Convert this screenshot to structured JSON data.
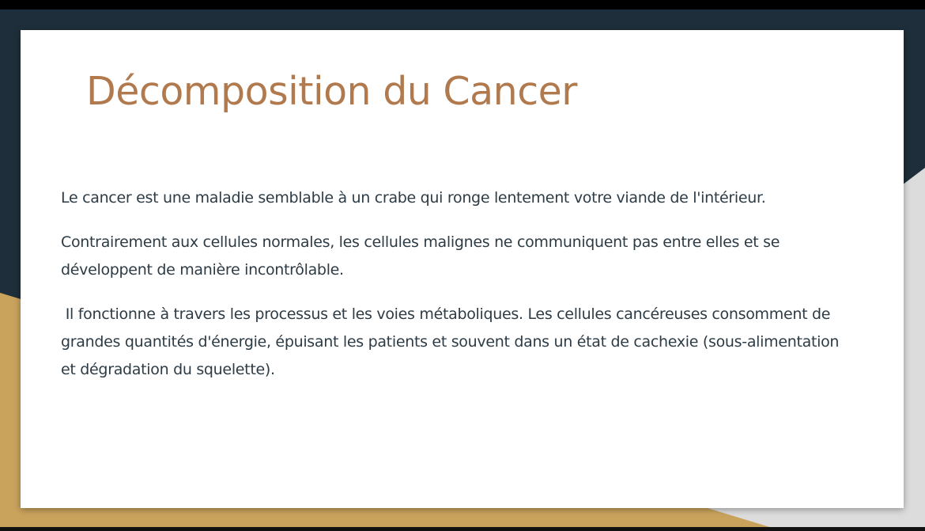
{
  "slide": {
    "title": "Décomposition du Cancer",
    "paragraphs": [
      "Le cancer est une maladie semblable à un crabe qui ronge lentement votre viande de l'intérieur.",
      "Contrairement aux cellules normales, les cellules malignes ne communiquent pas entre elles et se développent de manière incontrôlable.",
      " Il fonctionne à travers les processus et les voies métaboliques. Les cellules cancéreuses consomment de grandes quantités d'énergie, épuisant les patients et souvent dans un état de cachexie (sous-alimentation et dégradation du squelette)."
    ]
  },
  "colors": {
    "title": "#b07a4e",
    "body_text": "#2d3b45",
    "dark_navy": "#1e2f3b",
    "gold": "#c9a35c",
    "light_gray": "#dcdcdc"
  }
}
